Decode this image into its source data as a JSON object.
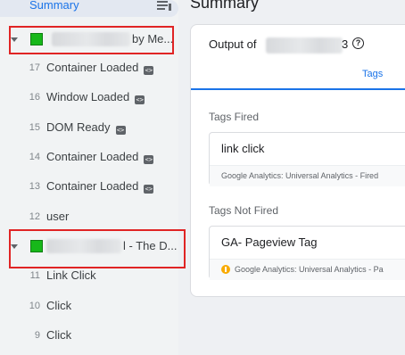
{
  "sidebar": {
    "summary_label": "Summary",
    "summary_icon": "list-filter-icon",
    "pages": [
      {
        "title_suffix": "by Me...",
        "caret_icon": "caret-down-icon",
        "favicon": "green-square-icon"
      },
      {
        "title_suffix": "l - The D...",
        "caret_icon": "caret-down-icon",
        "favicon": "green-square-icon"
      }
    ],
    "events_page1": [
      {
        "num": "17",
        "label": "Container Loaded",
        "badge": true
      },
      {
        "num": "16",
        "label": "Window Loaded",
        "badge": true
      },
      {
        "num": "15",
        "label": "DOM Ready",
        "badge": true
      },
      {
        "num": "14",
        "label": "Container Loaded",
        "badge": true
      },
      {
        "num": "13",
        "label": "Container Loaded",
        "badge": true
      },
      {
        "num": "12",
        "label": "user",
        "badge": false
      }
    ],
    "events_page2": [
      {
        "num": "11",
        "label": "Link Click",
        "badge": false
      },
      {
        "num": "10",
        "label": "Click",
        "badge": false
      },
      {
        "num": "9",
        "label": "Click",
        "badge": false
      }
    ],
    "badge_glyph": "<>"
  },
  "main": {
    "title": "Summary",
    "output_title": "Output of",
    "output_suffix": "3",
    "help_glyph": "?",
    "tab_tags": "Tags",
    "tags_fired": {
      "heading": "Tags Fired",
      "items": [
        {
          "name": "link click",
          "type": "Google Analytics: Universal Analytics - Fired"
        }
      ]
    },
    "tags_not_fired": {
      "heading": "Tags Not Fired",
      "items": [
        {
          "name": "GA- Pageview Tag",
          "type": "Google Analytics: Universal Analytics - Pa"
        }
      ]
    }
  },
  "colors": {
    "accent": "#1a73e8",
    "highlight_outline": "#e02424",
    "favicon_green": "#17b81a",
    "warning": "#f9ab00"
  }
}
